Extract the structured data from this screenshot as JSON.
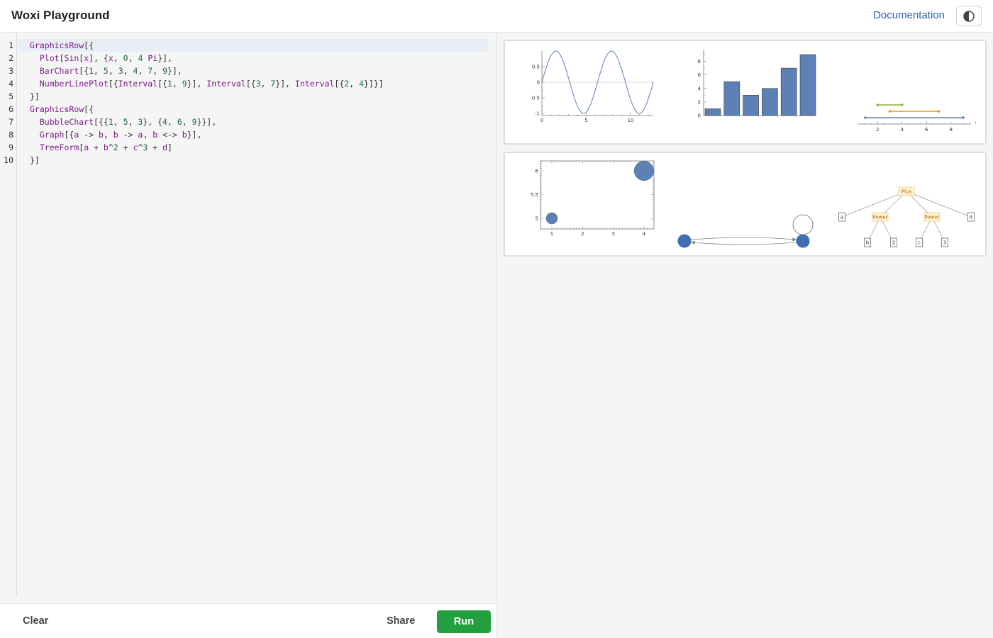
{
  "header": {
    "title": "Woxi Playground",
    "documentation_label": "Documentation",
    "theme_icon": "contrast-icon"
  },
  "editor": {
    "line_numbers": [
      "1",
      "2",
      "3",
      "4",
      "5",
      "6",
      "7",
      "8",
      "9",
      "10"
    ],
    "lines": [
      "GraphicsRow[{",
      "  Plot[Sin[x], {x, 0, 4 Pi}],",
      "  BarChart[{1, 5, 3, 4, 7, 9}],",
      "  NumberLinePlot[{Interval[{1, 9}], Interval[{3, 7}], Interval[{2, 4}]}]",
      "}]",
      "GraphicsRow[{",
      "  BubbleChart[{{1, 5, 3}, {4, 6, 9}}],",
      "  Graph[{a -> b, b -> a, b <-> b}],",
      "  TreeForm[a + b^2 + c^3 + d]",
      "}]"
    ]
  },
  "footer": {
    "clear_label": "Clear",
    "share_label": "Share",
    "run_label": "Run"
  },
  "colors": {
    "series_blue": "#5e81b5",
    "series_orange": "#e19c24",
    "series_green": "#8fb032",
    "run_green": "#22a040",
    "link_blue": "#2e64a8"
  },
  "chart_data": [
    {
      "type": "line",
      "function": "Sin[x]",
      "x_range": [
        0,
        12.566
      ],
      "ylim": [
        -1,
        1
      ],
      "x_ticks": [
        "0",
        "5",
        "10"
      ],
      "y_ticks": [
        "0.5",
        "0",
        "-0.5",
        "-1"
      ]
    },
    {
      "type": "bar",
      "values": [
        1,
        5,
        3,
        4,
        7,
        9
      ],
      "ylim": [
        0,
        9
      ],
      "y_ticks": [
        "8",
        "6",
        "4",
        "2",
        "0"
      ]
    },
    {
      "type": "scatter",
      "kind": "number-line",
      "intervals": [
        [
          1,
          9
        ],
        [
          3,
          7
        ],
        [
          2,
          4
        ]
      ],
      "x_ticks": [
        "2",
        "4",
        "6",
        "8"
      ]
    },
    {
      "type": "scatter",
      "kind": "bubble",
      "points": [
        {
          "x": 1,
          "y": 5,
          "size": 3
        },
        {
          "x": 4,
          "y": 6,
          "size": 9
        }
      ],
      "x_ticks": [
        "1",
        "2",
        "3",
        "4"
      ],
      "y_ticks": [
        "6",
        "5.5",
        "5"
      ]
    }
  ],
  "graph": {
    "edges": [
      "a -> b",
      "b -> a",
      "b <-> b"
    ]
  },
  "tree": {
    "root": "Plus",
    "level1": [
      "a",
      "Power",
      "Power",
      "d"
    ],
    "level2": [
      "b",
      "2",
      "c",
      "3"
    ]
  }
}
